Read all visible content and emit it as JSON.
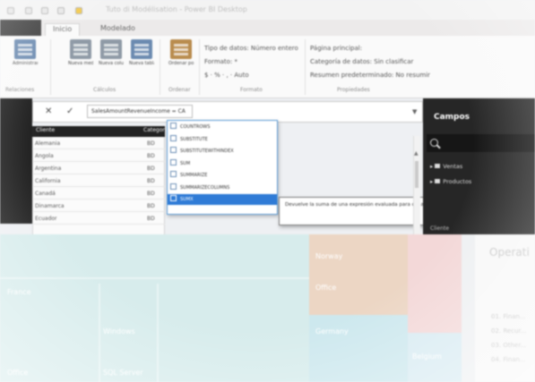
{
  "window": {
    "title": "Tuto di Modélisation - Power BI Desktop"
  },
  "ribbon": {
    "tabs": [
      "Inicio",
      "Modelado"
    ],
    "buttons": [
      {
        "label": "Administrar relaciones"
      },
      {
        "label": "Nueva medida"
      },
      {
        "label": "Nueva columna"
      },
      {
        "label": "Nueva tabla"
      },
      {
        "label": "Ordenar por columna"
      }
    ],
    "format_rows": [
      "Tipo de datos: Número entero",
      "Formato: *",
      "$ · % · , · Auto"
    ],
    "property_rows": [
      "Página principal:",
      "Categoría de datos: Sin clasificar",
      "Resumen predeterminado: No resumir"
    ],
    "groups": [
      "Relaciones",
      "Cálculos",
      "Ordenar",
      "Formato",
      "Propiedades"
    ]
  },
  "formula_bar": {
    "cancel_symbol": "✕",
    "commit_symbol": "✓",
    "name_value": "SalesAmountRevenueIncome = CA"
  },
  "table": {
    "headers": [
      "Cliente",
      "Categoría"
    ],
    "rows": [
      {
        "cliente": "Alemania",
        "categoria": "BD"
      },
      {
        "cliente": "Angola",
        "categoria": "BD"
      },
      {
        "cliente": "Argentina",
        "categoria": "BD"
      },
      {
        "cliente": "California",
        "categoria": "BD"
      },
      {
        "cliente": "Canadá",
        "categoria": "BD"
      },
      {
        "cliente": "Dinamarca",
        "categoria": "BD"
      },
      {
        "cliente": "Ecuador",
        "categoria": "BD"
      }
    ]
  },
  "autocomplete": {
    "items": [
      {
        "label": "COUNTROWS",
        "selected": false
      },
      {
        "label": "SUBSTITUTE",
        "selected": false
      },
      {
        "label": "SUBSTITUTEWITHINDEX",
        "selected": false
      },
      {
        "label": "SUM",
        "selected": false
      },
      {
        "label": "SUMMARIZE",
        "selected": false
      },
      {
        "label": "SUMMARIZECOLUMNS",
        "selected": false
      },
      {
        "label": "SUMX",
        "selected": true
      }
    ],
    "tooltip": "Devuelve la suma de una expresión evaluada para cada fila de una tabla."
  },
  "fields_pane": {
    "title": "Campos",
    "items": [
      "Ventas",
      "Productos"
    ],
    "footer": "Cliente"
  },
  "canvas": {
    "labels": [
      "France",
      "Office",
      "Windows",
      "SQL Server",
      "Norway",
      "Office",
      "Germany",
      "Belgium"
    ],
    "right_panel_title": "Operati",
    "right_list": [
      "01. Finan...",
      "02. Recur...",
      "03. Other...",
      "04. Finan..."
    ]
  }
}
